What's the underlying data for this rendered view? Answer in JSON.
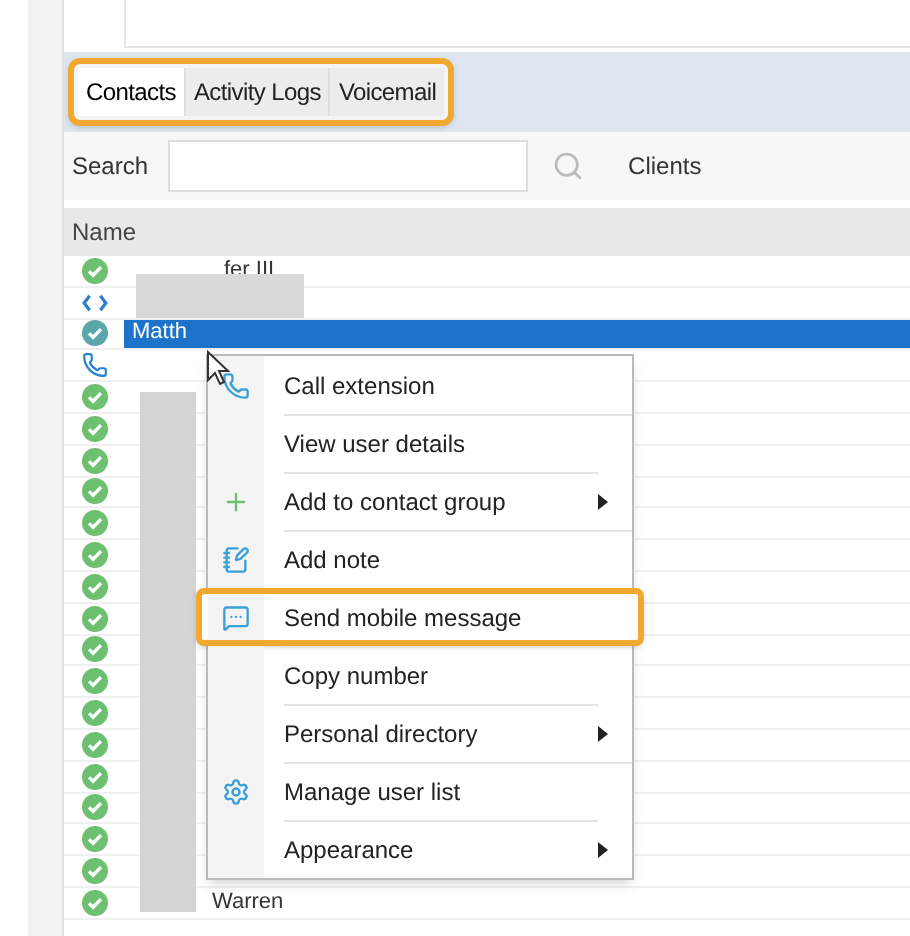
{
  "tabs": [
    {
      "label": "Contacts",
      "selected": true
    },
    {
      "label": "Activity Logs",
      "selected": false
    },
    {
      "label": "Voicemail",
      "selected": false
    }
  ],
  "search": {
    "label": "Search",
    "filter": "Clients"
  },
  "table": {
    "columns": [
      "Name"
    ],
    "rows": [
      {
        "kind": "available",
        "name": "fer III",
        "selected": false
      },
      {
        "kind": "forwarding",
        "selected": false
      },
      {
        "kind": "available",
        "name": "Matth",
        "selected": true
      },
      {
        "kind": "ringing",
        "selected": false
      },
      {
        "kind": "available",
        "selected": false
      },
      {
        "kind": "available",
        "selected": false
      },
      {
        "kind": "available",
        "selected": false
      },
      {
        "kind": "available",
        "selected": false
      },
      {
        "kind": "available",
        "selected": false
      },
      {
        "kind": "available",
        "selected": false
      },
      {
        "kind": "available",
        "selected": false
      },
      {
        "kind": "available",
        "selected": false
      },
      {
        "kind": "available",
        "selected": false
      },
      {
        "kind": "available",
        "selected": false
      },
      {
        "kind": "available",
        "selected": false
      },
      {
        "kind": "available",
        "selected": false
      },
      {
        "kind": "available",
        "selected": false
      },
      {
        "kind": "available",
        "selected": false
      },
      {
        "kind": "available",
        "selected": false
      },
      {
        "kind": "available",
        "selected": false
      },
      {
        "kind": "available",
        "name": "Warren",
        "selected": false
      }
    ]
  },
  "context_menu": {
    "items": [
      {
        "label": "Call extension",
        "kind": "phone",
        "submenu": false,
        "highlighted": false
      },
      {
        "label": "View user details",
        "submenu": false,
        "highlighted": false
      },
      {
        "label": "Add to contact group",
        "kind": "plus",
        "submenu": true,
        "highlighted": false
      },
      {
        "label": "Add note",
        "kind": "note",
        "submenu": false,
        "highlighted": false
      },
      {
        "label": "Send mobile message",
        "kind": "chat",
        "submenu": false,
        "highlighted": true
      },
      {
        "label": "Copy number",
        "submenu": false,
        "highlighted": false
      },
      {
        "label": "Personal directory",
        "submenu": true,
        "highlighted": false
      },
      {
        "label": "Manage user list",
        "kind": "gear",
        "submenu": false,
        "highlighted": false
      },
      {
        "label": "Appearance",
        "submenu": true,
        "highlighted": false
      }
    ]
  }
}
